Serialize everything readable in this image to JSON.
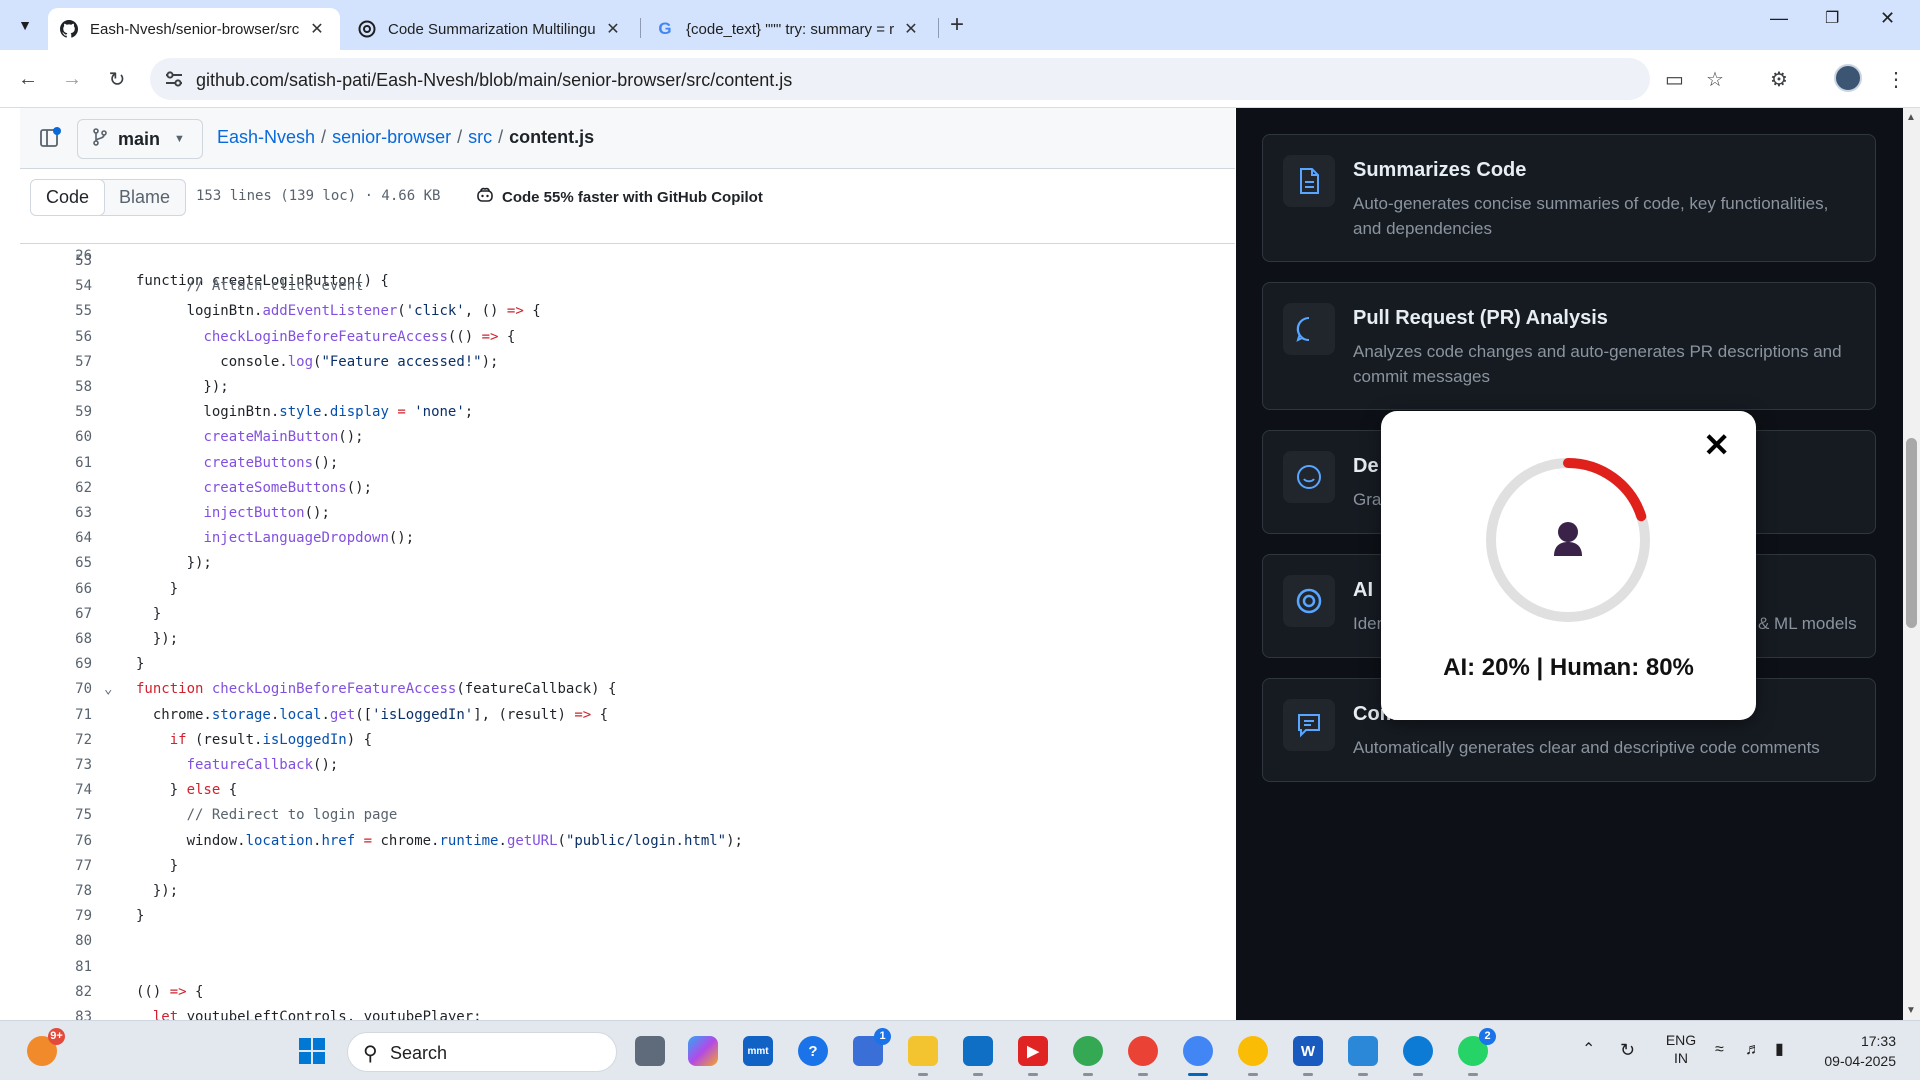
{
  "browser": {
    "tabs": [
      {
        "title": "Eash-Nvesh/senior-browser/src",
        "icon": "github-icon",
        "active": true
      },
      {
        "title": "Code Summarization Multilingu",
        "icon": "openai-icon",
        "active": false
      },
      {
        "title": "{code_text} \"\"\" try: summary = r",
        "icon": "google-icon",
        "active": false
      }
    ],
    "url": "github.com/satish-pati/Eash-Nvesh/blob/main/senior-browser/src/content.js"
  },
  "github": {
    "branch": "main",
    "breadcrumb": {
      "repo": "Eash-Nvesh",
      "dir1": "senior-browser",
      "dir2": "src",
      "file": "content.js"
    },
    "tabs": {
      "code": "Code",
      "blame": "Blame"
    },
    "file_meta": "153 lines (139 loc) · 4.66 KB",
    "copilot_text": "Code 55% faster with GitHub Copilot",
    "sticky_line": {
      "num": "26",
      "text": "function createLoginButton() {"
    },
    "lines": [
      {
        "num": "53",
        "text": ""
      },
      {
        "num": "54",
        "text": "      // Attach click event"
      },
      {
        "num": "55",
        "text": "      loginBtn.addEventListener('click', () => {"
      },
      {
        "num": "56",
        "text": "        checkLoginBeforeFeatureAccess(() => {"
      },
      {
        "num": "57",
        "text": "          console.log(\"Feature accessed!\");"
      },
      {
        "num": "58",
        "text": "        });"
      },
      {
        "num": "59",
        "text": "        loginBtn.style.display = 'none';"
      },
      {
        "num": "60",
        "text": "        createMainButton();"
      },
      {
        "num": "61",
        "text": "        createButtons();"
      },
      {
        "num": "62",
        "text": "        createSomeButtons();"
      },
      {
        "num": "63",
        "text": "        injectButton();"
      },
      {
        "num": "64",
        "text": "        injectLanguageDropdown();"
      },
      {
        "num": "65",
        "text": "      });"
      },
      {
        "num": "66",
        "text": "    }"
      },
      {
        "num": "67",
        "text": "  }"
      },
      {
        "num": "68",
        "text": "  });"
      },
      {
        "num": "69",
        "text": "}"
      },
      {
        "num": "70",
        "text": "function checkLoginBeforeFeatureAccess(featureCallback) {"
      },
      {
        "num": "71",
        "text": "  chrome.storage.local.get(['isLoggedIn'], (result) => {"
      },
      {
        "num": "72",
        "text": "    if (result.isLoggedIn) {"
      },
      {
        "num": "73",
        "text": "      featureCallback();"
      },
      {
        "num": "74",
        "text": "    } else {"
      },
      {
        "num": "75",
        "text": "      // Redirect to login page"
      },
      {
        "num": "76",
        "text": "      window.location.href = chrome.runtime.getURL(\"public/login.html\");"
      },
      {
        "num": "77",
        "text": "    }"
      },
      {
        "num": "78",
        "text": "  });"
      },
      {
        "num": "79",
        "text": "}"
      },
      {
        "num": "80",
        "text": ""
      },
      {
        "num": "81",
        "text": ""
      },
      {
        "num": "82",
        "text": "(() => {"
      },
      {
        "num": "83",
        "text": "  let youtubeLeftControls, youtubePlayer;"
      }
    ]
  },
  "panel": {
    "cards": [
      {
        "title": "Summarizes Code",
        "desc": "Auto-generates concise summaries of code, key functionalities, and dependencies",
        "icon": "document-icon"
      },
      {
        "title": "Pull Request (PR) Analysis",
        "desc": "Analyzes code changes and auto-generates PR descriptions and commit messages",
        "icon": "chat-bubble-icon"
      },
      {
        "title": "De",
        "desc": "Gra",
        "icon": "smile-icon"
      },
      {
        "title": "AI",
        "desc": "Iden",
        "desc_right": "& ML models",
        "icon": "target-icon"
      },
      {
        "title": "Com",
        "desc": "Automatically generates clear and descriptive code comments",
        "icon": "comment-icon"
      }
    ]
  },
  "popup": {
    "close_symbol": "✕",
    "verdict": "AI: 20% | Human: 80%",
    "ai_fraction": 0.2,
    "ring_color": "#e0201b"
  },
  "taskbar": {
    "search": "Search",
    "lang": "ENG",
    "region": "IN",
    "time": "17:33",
    "date": "09-04-2025",
    "badges": {
      "store": "1",
      "whatsapp": "2",
      "weather": "9+"
    }
  }
}
